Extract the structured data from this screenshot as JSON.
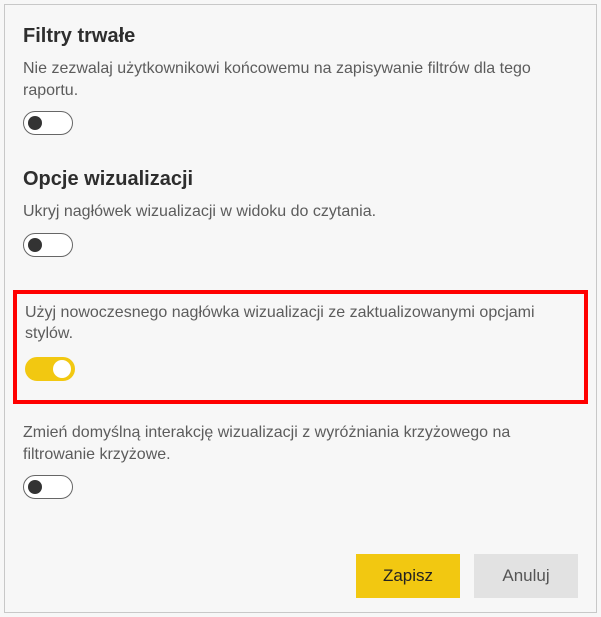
{
  "sections": {
    "filters": {
      "heading": "Filtry trwałe",
      "persist": {
        "label": "Nie zezwalaj użytkownikowi końcowemu na zapisywanie filtrów dla tego raportu.",
        "on": false
      }
    },
    "visualization": {
      "heading": "Opcje wizualizacji",
      "hideHeader": {
        "label": "Ukryj nagłówek wizualizacji w widoku do czytania.",
        "on": false
      },
      "modernHeader": {
        "label": "Użyj nowoczesnego nagłówka wizualizacji ze zaktualizowanymi opcjami stylów.",
        "on": true
      },
      "crossFilter": {
        "label": "Zmień domyślną interakcję wizualizacji z wyróżniania krzyżowego na filtrowanie krzyżowe.",
        "on": false
      }
    }
  },
  "footer": {
    "save": "Zapisz",
    "cancel": "Anuluj"
  }
}
